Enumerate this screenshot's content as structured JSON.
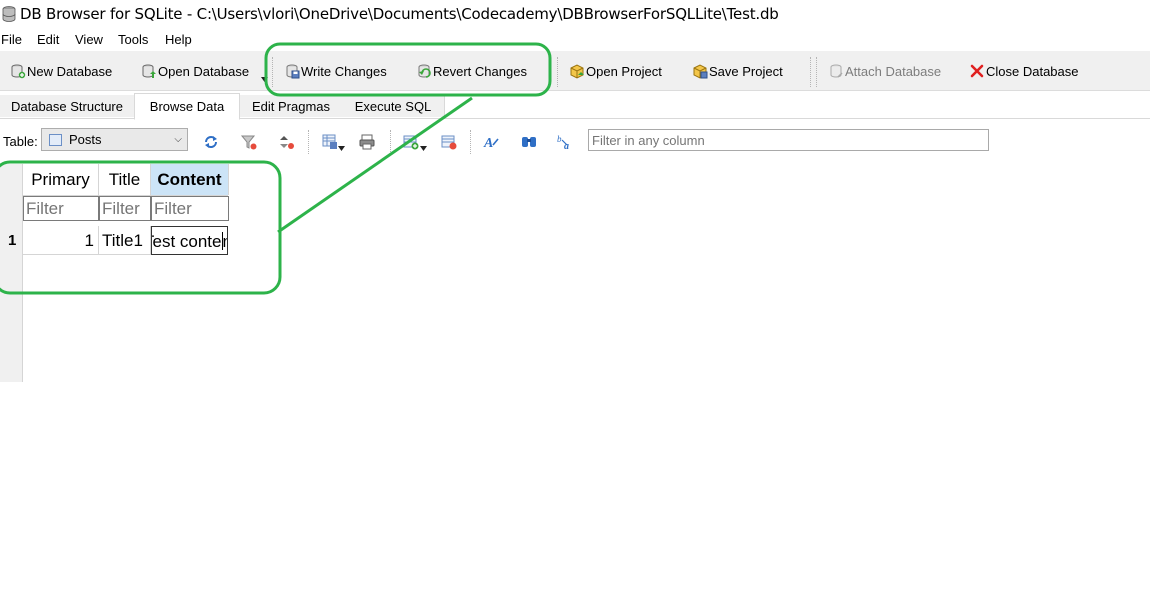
{
  "window": {
    "title": "DB Browser for SQLite - C:\\Users\\vlori\\OneDrive\\Documents\\Codecademy\\DBBrowserForSQLLite\\Test.db"
  },
  "menu": [
    "File",
    "Edit",
    "View",
    "Tools",
    "Help"
  ],
  "toolbar": {
    "new_database": "New Database",
    "open_database": "Open Database",
    "write_changes": "Write Changes",
    "revert_changes": "Revert Changes",
    "open_project": "Open Project",
    "save_project": "Save Project",
    "attach_database": "Attach Database",
    "close_database": "Close Database"
  },
  "tabs": [
    "Database Structure",
    "Browse Data",
    "Edit Pragmas",
    "Execute SQL"
  ],
  "active_tab": "Browse Data",
  "browse": {
    "table_label": "Table:",
    "table_selected": "Posts",
    "filter_placeholder": "Filter in any column"
  },
  "grid": {
    "columns": [
      "Primary",
      "Title",
      "Content"
    ],
    "filter_placeholder": "Filter",
    "rows": [
      {
        "row_num": "1",
        "primary": "1",
        "title": "Title1",
        "content_before_cursor": "Test conte",
        "content_after_cursor": "nt"
      }
    ]
  },
  "colors": {
    "annotation_green": "#2db34a",
    "header_highlight": "#cce4f7",
    "toolbar_bg": "#f0f0f0"
  }
}
